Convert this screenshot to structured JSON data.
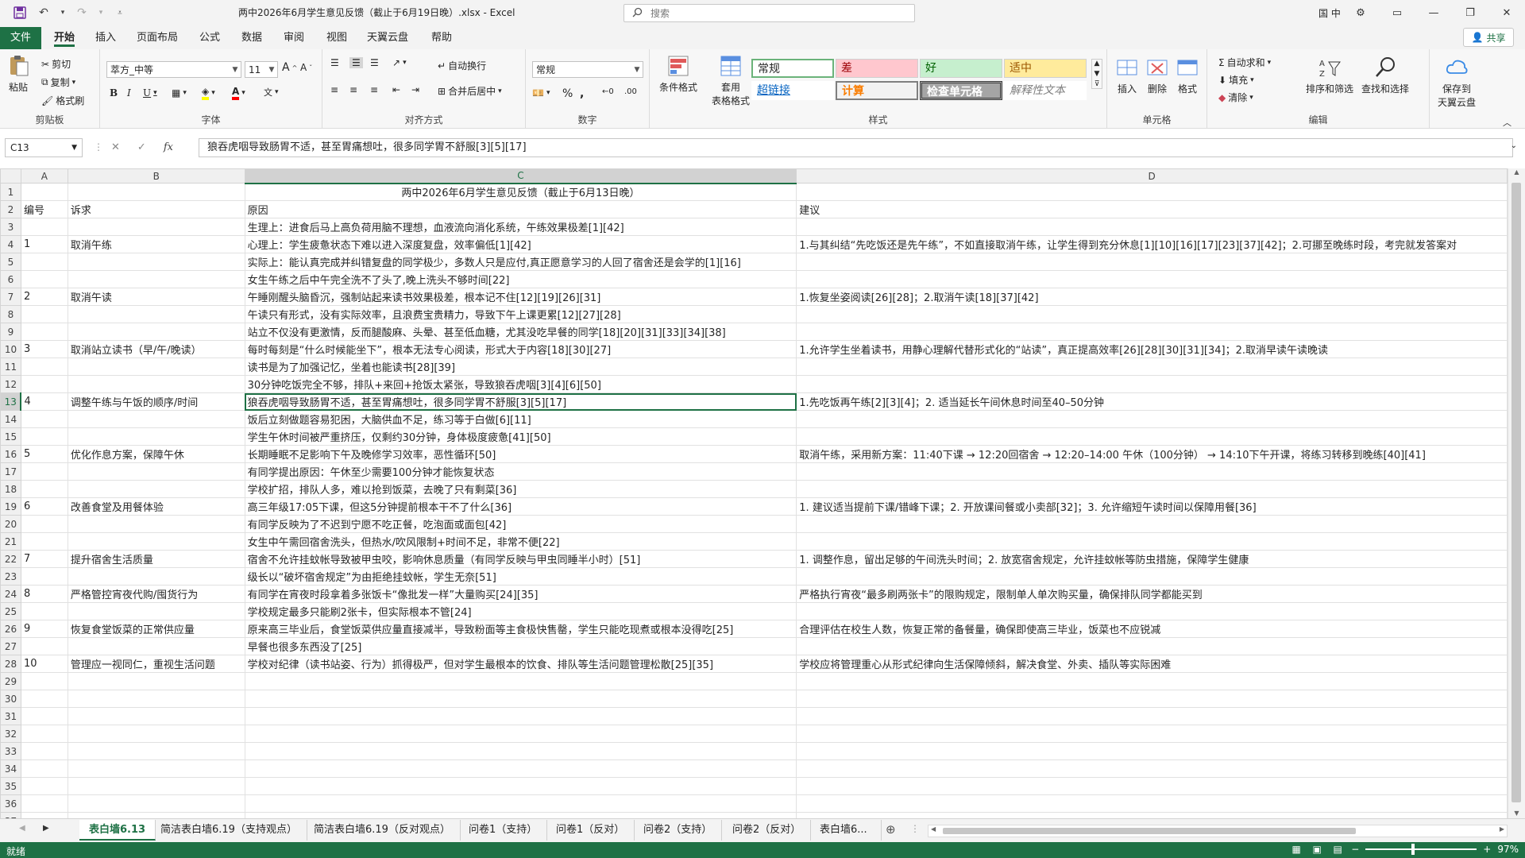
{
  "titlebar": {
    "title": "两中2026年6月学生意见反馈（截止于6月19日晚）.xlsx  -  Excel",
    "search_placeholder": "搜索",
    "lang": "国 中"
  },
  "menu": [
    "文件",
    "开始",
    "插入",
    "页面布局",
    "公式",
    "数据",
    "审阅",
    "视图",
    "天翼云盘",
    "帮助"
  ],
  "share_label": "共享",
  "ribbon": {
    "clipboard": {
      "paste": "粘贴",
      "cut": "剪切",
      "copy": "复制",
      "format_painter": "格式刷",
      "label": "剪贴板"
    },
    "font": {
      "name": "萃方_中等",
      "size": "11",
      "label": "字体"
    },
    "align": {
      "wrap": "自动换行",
      "merge": "合并后居中",
      "label": "对齐方式"
    },
    "number": {
      "format": "常规",
      "label": "数字"
    },
    "styles": {
      "cond_format": "条件格式",
      "table_format": "套用\n表格格式",
      "cells": [
        "常规",
        "差",
        "好",
        "适中",
        "超链接",
        "计算",
        "检查单元格",
        "解释性文本"
      ],
      "label": "样式"
    },
    "cells": {
      "insert": "插入",
      "delete": "删除",
      "format": "格式",
      "label": "单元格"
    },
    "editing": {
      "autosum": "自动求和",
      "fill": "填充",
      "clear": "清除",
      "sort": "排序和筛选",
      "find": "查找和选择",
      "label": "编辑"
    },
    "cloud": {
      "save": "保存到\n天翼云盘"
    }
  },
  "formula": {
    "namebox": "C13",
    "content": "狼吞虎咽导致肠胃不适，甚至胃痛想吐，很多同学胃不舒服[3][5][17]"
  },
  "columns": [
    "A",
    "B",
    "C",
    "D"
  ],
  "rows": [
    {
      "n": "1",
      "a": "",
      "b": "",
      "c": "两中2026年6月学生意见反馈（截止于6月13日晚）",
      "d": ""
    },
    {
      "n": "2",
      "a": "编号",
      "b": "诉求",
      "c": "原因",
      "d": "建议"
    },
    {
      "n": "3",
      "a": "",
      "b": "",
      "c": "生理上：进食后马上高负荷用脑不理想，血液流向消化系统，午练效果极差[1][42]",
      "d": ""
    },
    {
      "n": "4",
      "a": "1",
      "b": "取消午练",
      "c": "心理上：学生疲惫状态下难以进入深度复盘，效率偏低[1][42]",
      "d": "1.与其纠结“先吃饭还是先午练”，不如直接取消午练，让学生得到充分休息[1][10][16][17][23][37][42]；2.可挪至晚练时段，考完就发答案对"
    },
    {
      "n": "5",
      "a": "",
      "b": "",
      "c": "实际上：能认真完成并纠错复盘的同学极少，多数人只是应付,真正愿意学习的人回了宿舍还是会学的[1][16]",
      "d": ""
    },
    {
      "n": "6",
      "a": "",
      "b": "",
      "c": "女生午练之后中午完全洗不了头了,晚上洗头不够时间[22]",
      "d": ""
    },
    {
      "n": "7",
      "a": "2",
      "b": "取消午读",
      "c": "午睡刚醒头脑昏沉，强制站起来读书效果极差，根本记不住[12][19][26][31]",
      "d": "1.恢复坐姿阅读[26][28]；2.取消午读[18][37][42]"
    },
    {
      "n": "8",
      "a": "",
      "b": "",
      "c": "午读只有形式，没有实际效率，且浪费宝贵精力，导致下午上课更累[12][27][28]",
      "d": ""
    },
    {
      "n": "9",
      "a": "",
      "b": "",
      "c": "站立不仅没有更激情，反而腿酸麻、头晕、甚至低血糖，尤其没吃早餐的同学[18][20][31][33][34][38]",
      "d": ""
    },
    {
      "n": "10",
      "a": "3",
      "b": "取消站立读书（早/午/晚读）",
      "c": "每时每刻是“什么时候能坐下”，根本无法专心阅读，形式大于内容[18][30][27]",
      "d": "1.允许学生坐着读书，用静心理解代替形式化的“站读”，真正提高效率[26][28][30][31][34]；2.取消早读午读晚读"
    },
    {
      "n": "11",
      "a": "",
      "b": "",
      "c": "读书是为了加强记忆，坐着也能读书[28][39]",
      "d": ""
    },
    {
      "n": "12",
      "a": "",
      "b": "",
      "c": "30分钟吃饭完全不够，排队+来回+抢饭太紧张，导致狼吞虎咽[3][4][6][50]",
      "d": ""
    },
    {
      "n": "13",
      "a": "4",
      "b": "调整午练与午饭的顺序/时间",
      "c": "狼吞虎咽导致肠胃不适，甚至胃痛想吐，很多同学胃不舒服[3][5][17]",
      "d": "1.先吃饭再午练[2][3][4]；2. 适当延长午间休息时间至40–50分钟"
    },
    {
      "n": "14",
      "a": "",
      "b": "",
      "c": "饭后立刻做题容易犯困，大脑供血不足，练习等于白做[6][11]",
      "d": ""
    },
    {
      "n": "15",
      "a": "",
      "b": "",
      "c": "学生午休时间被严重挤压，仅剩约30分钟，身体极度疲惫[41][50]",
      "d": ""
    },
    {
      "n": "16",
      "a": "5",
      "b": "优化作息方案，保障午休",
      "c": "长期睡眠不足影响下午及晚修学习效率，恶性循环[50]",
      "d": "取消午练，采用新方案：11:40下课 → 12:20回宿舍 → 12:20–14:00 午休（100分钟） → 14:10下午开课，将练习转移到晚练[40][41]"
    },
    {
      "n": "17",
      "a": "",
      "b": "",
      "c": "有同学提出原因：午休至少需要100分钟才能恢复状态",
      "d": ""
    },
    {
      "n": "18",
      "a": "",
      "b": "",
      "c": "学校扩招，排队人多，难以抢到饭菜，去晚了只有剩菜[36]",
      "d": ""
    },
    {
      "n": "19",
      "a": "6",
      "b": "改善食堂及用餐体验",
      "c": "高三年级17:05下课，但这5分钟提前根本干不了什么[36]",
      "d": "1. 建议适当提前下课/错峰下课；2. 开放课间餐或小卖部[32]；3. 允许缩短午读时间以保障用餐[36]"
    },
    {
      "n": "20",
      "a": "",
      "b": "",
      "c": "有同学反映为了不迟到宁愿不吃正餐，吃泡面或面包[42]",
      "d": ""
    },
    {
      "n": "21",
      "a": "",
      "b": "",
      "c": "女生中午需回宿舍洗头，但热水/吹风限制+时间不足，非常不便[22]",
      "d": ""
    },
    {
      "n": "22",
      "a": "7",
      "b": "提升宿舍生活质量",
      "c": "宿舍不允许挂蚊帐导致被甲虫咬，影响休息质量（有同学反映与甲虫同睡半小时）[51]",
      "d": "1. 调整作息，留出足够的午间洗头时间；2. 放宽宿舍规定，允许挂蚊帐等防虫措施，保障学生健康"
    },
    {
      "n": "23",
      "a": "",
      "b": "",
      "c": "级长以“破坏宿舍规定”为由拒绝挂蚊帐，学生无奈[51]",
      "d": ""
    },
    {
      "n": "24",
      "a": "8",
      "b": "严格管控宵夜代购/囤货行为",
      "c": "有同学在宵夜时段拿着多张饭卡“像批发一样”大量购买[24][35]",
      "d": "严格执行宵夜“最多刷两张卡”的限购规定，限制单人单次购买量，确保排队同学都能买到"
    },
    {
      "n": "25",
      "a": "",
      "b": "",
      "c": "学校规定最多只能刷2张卡，但实际根本不管[24]",
      "d": ""
    },
    {
      "n": "26",
      "a": "9",
      "b": "恢复食堂饭菜的正常供应量",
      "c": "原来高三毕业后，食堂饭菜供应量直接减半，导致粉面等主食极快售罄，学生只能吃现煮或根本没得吃[25]",
      "d": "合理评估在校生人数，恢复正常的备餐量，确保即使高三毕业，饭菜也不应锐减"
    },
    {
      "n": "27",
      "a": "",
      "b": "",
      "c": "早餐也很多东西没了[25]",
      "d": ""
    },
    {
      "n": "28",
      "a": "10",
      "b": "管理应一视同仁，重视生活问题",
      "c": "学校对纪律（读书站姿、行为）抓得极严，但对学生最根本的饮食、排队等生活问题管理松散[25][35]",
      "d": "学校应将管理重心从形式纪律向生活保障倾斜，解决食堂、外卖、插队等实际困难"
    },
    {
      "n": "29",
      "a": "",
      "b": "",
      "c": "",
      "d": ""
    },
    {
      "n": "30",
      "a": "",
      "b": "",
      "c": "",
      "d": ""
    },
    {
      "n": "31",
      "a": "",
      "b": "",
      "c": "",
      "d": ""
    },
    {
      "n": "32",
      "a": "",
      "b": "",
      "c": "",
      "d": ""
    },
    {
      "n": "33",
      "a": "",
      "b": "",
      "c": "",
      "d": ""
    },
    {
      "n": "34",
      "a": "",
      "b": "",
      "c": "",
      "d": ""
    },
    {
      "n": "35",
      "a": "",
      "b": "",
      "c": "",
      "d": ""
    },
    {
      "n": "36",
      "a": "",
      "b": "",
      "c": "",
      "d": ""
    },
    {
      "n": "37",
      "a": "",
      "b": "",
      "c": "",
      "d": ""
    }
  ],
  "sheets": [
    "表白墙6.13",
    "简洁表白墙6.19（支持观点）",
    "简洁表白墙6.19（反对观点）",
    "问卷1（支持）",
    "问卷1（反对）",
    "问卷2（支持）",
    "问卷2（反对）",
    "表白墙6..."
  ],
  "status": {
    "text": "就绪",
    "zoom": "97%"
  },
  "colors": {
    "accent": "#1e7145",
    "bad": "#ffc7ce",
    "good": "#c6efce",
    "neutral": "#ffeb9c"
  }
}
